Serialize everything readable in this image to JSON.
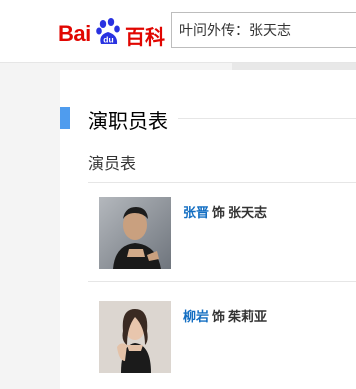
{
  "header": {
    "logo": {
      "text_bai": "Bai",
      "text_du": "du",
      "text_baike": "百科",
      "color": "#e10601"
    },
    "search": {
      "value": "叶问外传：张天志"
    }
  },
  "section": {
    "title": "演职员表",
    "accent_color": "#4f9cee",
    "subtitle": "演员表"
  },
  "cast": [
    {
      "actor": "张晋",
      "as": "饰",
      "role": "张天志"
    },
    {
      "actor": "柳岩",
      "as": "饰",
      "role": "茱莉亚"
    }
  ],
  "colors": {
    "link": "#136ec2",
    "text": "#333333"
  }
}
